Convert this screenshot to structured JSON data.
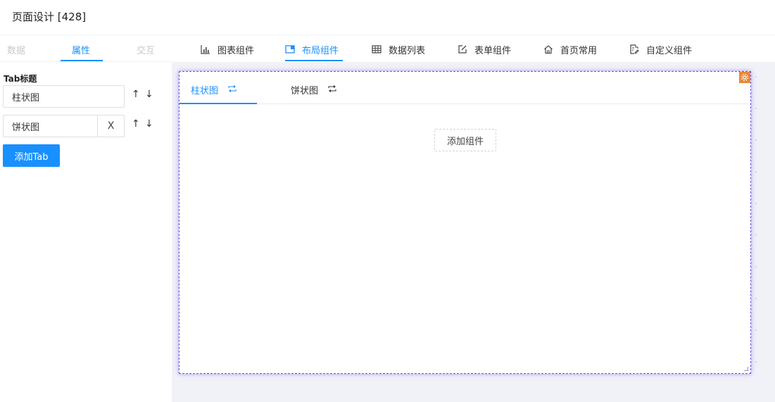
{
  "header": {
    "title": "页面设计 [428]"
  },
  "left_panel": {
    "tabs": [
      {
        "label": "数据",
        "active": false
      },
      {
        "label": "属性",
        "active": true
      },
      {
        "label": "交互",
        "active": false
      }
    ],
    "field_title": "Tab标题",
    "tab_items": [
      {
        "value": "柱状图",
        "deletable": false
      },
      {
        "value": "饼状图",
        "deletable": true,
        "delete_label": "X"
      }
    ],
    "arrow_up": "↑",
    "arrow_down": "↓",
    "add_tab_label": "添加Tab"
  },
  "toolbar": {
    "items": [
      {
        "label": "图表组件",
        "icon": "bar-chart-icon",
        "active": false
      },
      {
        "label": "布局组件",
        "icon": "layout-icon",
        "active": true
      },
      {
        "label": "数据列表",
        "icon": "table-icon",
        "active": false
      },
      {
        "label": "表单组件",
        "icon": "edit-form-icon",
        "active": false
      },
      {
        "label": "首页常用",
        "icon": "home-icon",
        "active": false
      },
      {
        "label": "自定义组件",
        "icon": "custom-doc-icon",
        "active": false
      }
    ]
  },
  "canvas": {
    "component_tabs": [
      {
        "label": "柱状图",
        "active": true
      },
      {
        "label": "饼状图",
        "active": false
      }
    ],
    "add_component_label": "添加组件"
  },
  "colors": {
    "primary": "#1890ff",
    "selection_border": "#6f56e0",
    "settings_badge": "#e8893b",
    "canvas_bg": "#f0f2f7"
  }
}
